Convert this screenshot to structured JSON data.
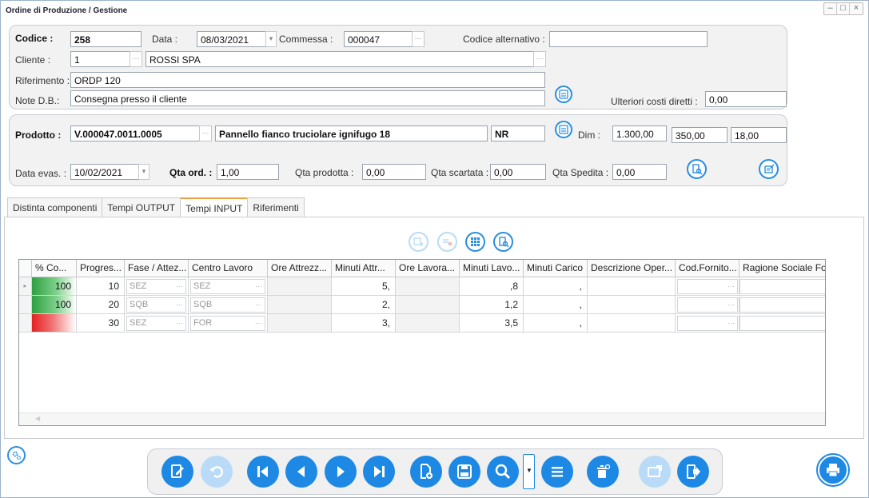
{
  "window": {
    "title": "Ordine di Produzione / Gestione",
    "min_icon": "minimize-icon",
    "max_icon": "maximize-icon",
    "close_icon": "close-icon"
  },
  "header": {
    "codice_label": "Codice :",
    "codice_value": "258",
    "data_label": "Data :",
    "data_value": "08/03/2021",
    "commessa_label": "Commessa :",
    "commessa_value": "000047",
    "codice_alt_label": "Codice alternativo :",
    "codice_alt_value": "",
    "cliente_label": "Cliente :",
    "cliente_code": "1",
    "cliente_name": "ROSSI SPA",
    "riferimento_label": "Riferimento :",
    "riferimento_value": "ORDP 120",
    "note_label": "Note D.B.:",
    "note_value": "Consegna presso il cliente",
    "costi_label": "Ulteriori costi diretti :",
    "costi_value": "0,00"
  },
  "product": {
    "prodotto_label": "Prodotto :",
    "prodotto_code": "V.000047.0011.0005",
    "prodotto_desc": "Pannello fianco truciolare ignifugo 18",
    "um": "NR",
    "dim_label": "Dim :",
    "dim1": "1.300,00",
    "dim2": "350,00",
    "dim3": "18,00",
    "data_evas_label": "Data evas. :",
    "data_evas_value": "10/02/2021",
    "qta_ord_label": "Qta ord. :",
    "qta_ord_value": "1,00",
    "qta_prod_label": "Qta prodotta :",
    "qta_prod_value": "0,00",
    "qta_scart_label": "Qta scartata :",
    "qta_scart_value": "0,00",
    "qta_sped_label": "Qta Spedita :",
    "qta_sped_value": "0,00"
  },
  "tabs": [
    {
      "label": "Distinta componenti"
    },
    {
      "label": "Tempi OUTPUT"
    },
    {
      "label": "Tempi INPUT"
    },
    {
      "label": "Riferimenti"
    }
  ],
  "grid": {
    "columns": [
      "% Co...",
      "Progres...",
      "Fase / Attez...",
      "Centro Lavoro",
      "Ore Attrezz...",
      "Minuti Attr...",
      "Ore Lavora...",
      "Minuti Lavo...",
      "Minuti Carico",
      "Descrizione Oper...",
      "Cod.Fornito...",
      "Ragione Sociale Forni"
    ],
    "rows": [
      {
        "pct": "100",
        "prog": "10",
        "fase": "SEZ",
        "centro": "SEZ",
        "ore_attr": "",
        "min_attr": "5,",
        "ore_lav": "",
        "min_lav": ",8",
        "min_car": ",",
        "descr": "",
        "cod_forn": "",
        "rag_soc": "",
        "status_color": "#2ea043"
      },
      {
        "pct": "100",
        "prog": "20",
        "fase": "SQB",
        "centro": "SQB",
        "ore_attr": "",
        "min_attr": "2,",
        "ore_lav": "",
        "min_lav": "1,2",
        "min_car": ",",
        "descr": "",
        "cod_forn": "",
        "rag_soc": "",
        "status_color": "#2ea043"
      },
      {
        "pct": "",
        "prog": "30",
        "fase": "SEZ",
        "centro": "FOR",
        "ore_attr": "",
        "min_attr": "3,",
        "ore_lav": "",
        "min_lav": "3,5",
        "min_car": ",",
        "descr": "",
        "cod_forn": "",
        "rag_soc": "",
        "status_color": "#e52222"
      }
    ]
  },
  "colors": {
    "accent": "#1e88e5",
    "accent_disabled": "#b9dbf7"
  }
}
